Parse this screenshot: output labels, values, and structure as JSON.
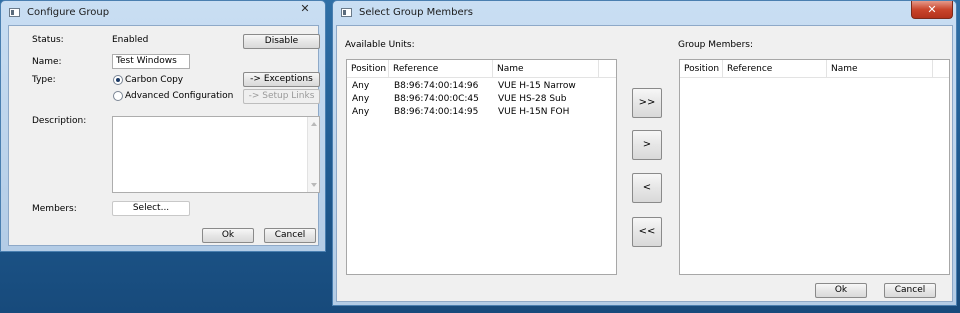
{
  "configure_group": {
    "title": "Configure Group",
    "close_glyph": "✕",
    "status_label": "Status:",
    "status_value": "Enabled",
    "disable_button": "Disable",
    "name_label": "Name:",
    "name_value": "Test Windows Group",
    "type_label": "Type:",
    "type_options": [
      {
        "label": "Carbon Copy",
        "selected": true
      },
      {
        "label": "Advanced Configuration",
        "selected": false
      }
    ],
    "exceptions_button": "-> Exceptions",
    "setup_links_button": "-> Setup Links",
    "description_label": "Description:",
    "description_value": "",
    "members_label": "Members:",
    "select_button": "Select...",
    "ok_button": "Ok",
    "cancel_button": "Cancel"
  },
  "select_members": {
    "title": "Select Group Members",
    "close_glyph": "✕",
    "available_label": "Available Units:",
    "group_members_label": "Group Members:",
    "columns": [
      "Position",
      "Reference",
      "Name"
    ],
    "available_units": [
      {
        "position": "Any",
        "reference": "B8:96:74:00:14:96",
        "name": "VUE H-15 Narrow"
      },
      {
        "position": "Any",
        "reference": "B8:96:74:00:0C:45",
        "name": "VUE HS-28 Sub"
      },
      {
        "position": "Any",
        "reference": "B8:96:74:00:14:95",
        "name": "VUE H-15N FOH"
      }
    ],
    "group_members": [],
    "move_all_right": ">>",
    "move_right": ">",
    "move_left": "<",
    "move_all_left": "<<",
    "ok_button": "Ok",
    "cancel_button": "Cancel"
  }
}
